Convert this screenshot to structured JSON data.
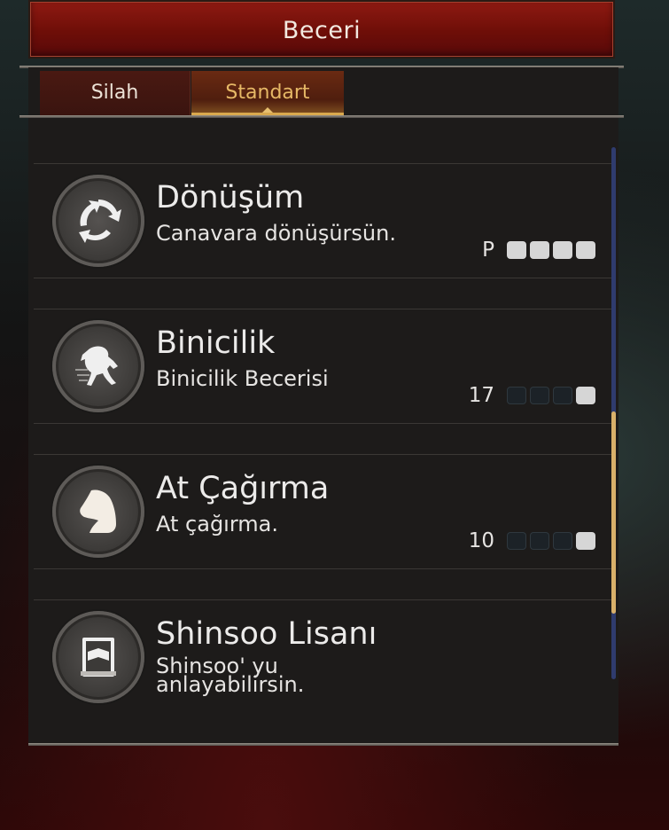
{
  "window": {
    "title": "Beceri"
  },
  "tabs": [
    {
      "label": "Silah",
      "active": false
    },
    {
      "label": "Standart",
      "active": true
    }
  ],
  "skills": [
    {
      "name": "Dönüşüm",
      "description": "Canavara dönüşürsün.",
      "level_label": "P",
      "pips_filled": 4,
      "pips_total": 4,
      "icon": "transform-icon"
    },
    {
      "name": "Binicilik",
      "description": "Binicilik Becerisi",
      "level_label": "17",
      "pips_filled": 1,
      "pips_total": 4,
      "icon": "horse-riding-icon"
    },
    {
      "name": "At Çağırma",
      "description": "At çağırma.",
      "level_label": "10",
      "pips_filled": 1,
      "pips_total": 4,
      "icon": "horse-head-icon"
    },
    {
      "name": "Shinsoo Lisanı",
      "description_line1": "Shinsoo' yu",
      "description_line2": "anlayabilirsin.",
      "icon": "book-icon"
    }
  ],
  "colors": {
    "title_bar": "#7a120c",
    "tab_active_text": "#e6b866",
    "scroll_thumb": "#d9b06a",
    "pip_on": "#d6d6d6"
  }
}
